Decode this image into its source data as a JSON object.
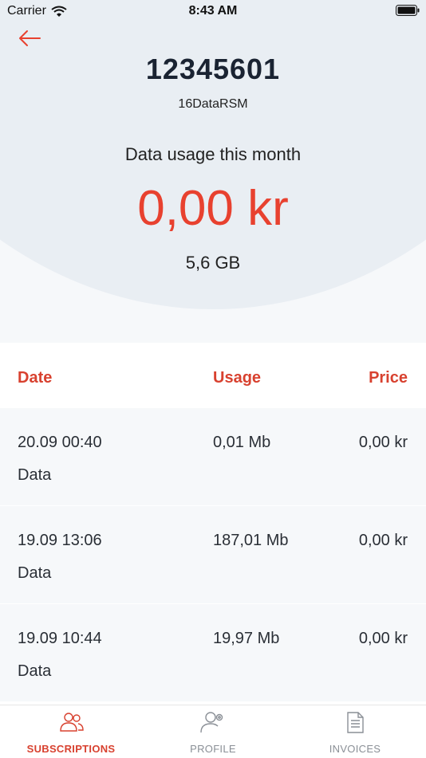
{
  "status_bar": {
    "carrier": "Carrier",
    "time": "8:43 AM"
  },
  "header": {
    "subscription_number": "12345601",
    "plan_name": "16DataRSM",
    "usage_label": "Data usage this month",
    "usage_amount": "0,00 kr",
    "usage_volume": "5,6 GB"
  },
  "table": {
    "columns": {
      "date": "Date",
      "usage": "Usage",
      "price": "Price"
    },
    "rows": [
      {
        "date": "20.09 00:40",
        "type": "Data",
        "usage": "0,01 Mb",
        "price": "0,00 kr"
      },
      {
        "date": "19.09 13:06",
        "type": "Data",
        "usage": "187,01 Mb",
        "price": "0,00 kr"
      },
      {
        "date": "19.09 10:44",
        "type": "Data",
        "usage": "19,97 Mb",
        "price": "0,00 kr"
      }
    ]
  },
  "tabs": [
    {
      "label": "SUBSCRIPTIONS",
      "icon": "users-icon",
      "active": true
    },
    {
      "label": "PROFILE",
      "icon": "user-settings-icon",
      "active": false
    },
    {
      "label": "INVOICES",
      "icon": "document-icon",
      "active": false
    }
  ],
  "colors": {
    "accent": "#e8412f",
    "header_bg": "#e9eef3",
    "row_bg": "#f6f8fa"
  }
}
